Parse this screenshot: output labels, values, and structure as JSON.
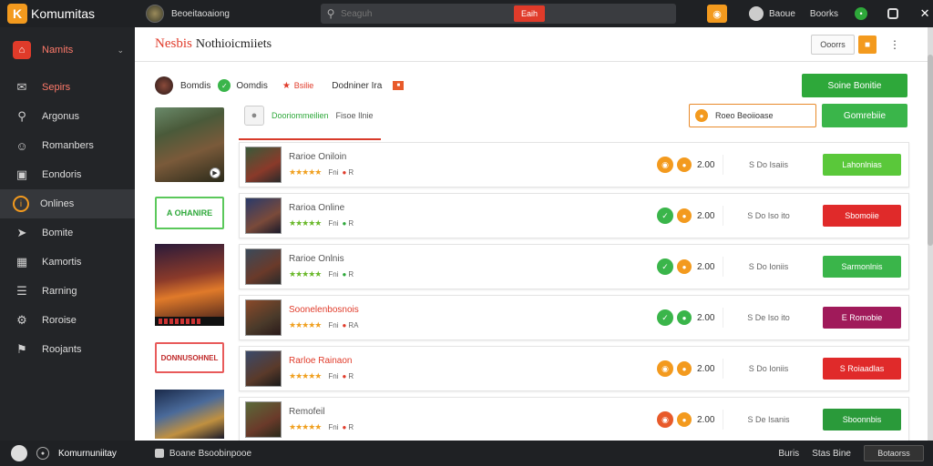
{
  "topbar": {
    "brand": "Komumitas",
    "game_name": "Beoeitaoaiong",
    "search_placeholder": "Seaguh",
    "search_button": "Eaih",
    "user_name": "Baoue",
    "link": "Boorks"
  },
  "sidebar": {
    "items": [
      {
        "label": "Namits",
        "icon": "home-icon"
      },
      {
        "label": "Sepirs",
        "icon": "megaphone-icon"
      },
      {
        "label": "Argonus",
        "icon": "search-icon"
      },
      {
        "label": "Romanbers",
        "icon": "users-icon"
      },
      {
        "label": "Eondoris",
        "icon": "chat-icon"
      },
      {
        "label": "Onlines",
        "icon": "orange-circle-icon"
      },
      {
        "label": "Bomite",
        "icon": "location-icon"
      },
      {
        "label": "Kamortis",
        "icon": "calendar-icon"
      },
      {
        "label": "Rarning",
        "icon": "list-icon"
      },
      {
        "label": "Roroise",
        "icon": "settings-icon"
      },
      {
        "label": "Roojants",
        "icon": "info-icon"
      }
    ]
  },
  "main": {
    "title_a": "Nesbis",
    "title_b": "Nothioicmiiets",
    "head_button": "Ooorrs",
    "filter": {
      "t1": "Bomdis",
      "t2": "Oomdis",
      "t3": "Bsilie",
      "t4": "Dodniner Ira"
    },
    "create_button": "Soine Bonitie",
    "sub_filter_a": "Dooriommeilien",
    "sub_filter_b": "Fisoe Ilnie",
    "search_box": "Roeo Beoiioase",
    "green_button": "Gomrebiie",
    "promo_green": "A OHANIRE",
    "promo_red_1": "DONNUS",
    "promo_red_2": "OHNEL"
  },
  "rows": [
    {
      "name": "Rarioe Oniloin",
      "meta": "R",
      "price": "2.00",
      "detail": "S Do Isaiis",
      "button": "Lahonlnias",
      "btn_color": "#5ac83a"
    },
    {
      "name": "Rarioa Online",
      "meta": "R",
      "price": "2.00",
      "detail": "S Do Iso ito",
      "button": "Sbomoiie",
      "btn_color": "#e02a2a"
    },
    {
      "name": "Rarioe Onlnis",
      "meta": "R",
      "price": "2.00",
      "detail": "S Do Ioniis",
      "button": "Sarmonlnis",
      "btn_color": "#3ab54a"
    },
    {
      "name": "Soonelenbosnois",
      "meta": "RA",
      "price": "2.00",
      "detail": "S De Iso ito",
      "button": "E Romobie",
      "btn_color": "#a01a5a"
    },
    {
      "name": "Rarloe Rainaon",
      "meta": "R",
      "price": "2.00",
      "detail": "S Do Ioniis",
      "button": "S Roiaadlas",
      "btn_color": "#e02a2a"
    },
    {
      "name": "Remofeil",
      "meta": "R",
      "price": "2.00",
      "detail": "S De Isanis",
      "button": "Sboonnbis",
      "btn_color": "#2a9a3a"
    }
  ],
  "bottombar": {
    "name": "Komurnuniitay",
    "mid": "Boane Bsoobinpooe",
    "link1": "Buris",
    "link2": "Stas Bine",
    "button": "Botaorss"
  },
  "colors": {
    "accent_orange": "#f39a1e",
    "accent_red": "#e03b2a",
    "accent_green": "#2ea83a"
  }
}
